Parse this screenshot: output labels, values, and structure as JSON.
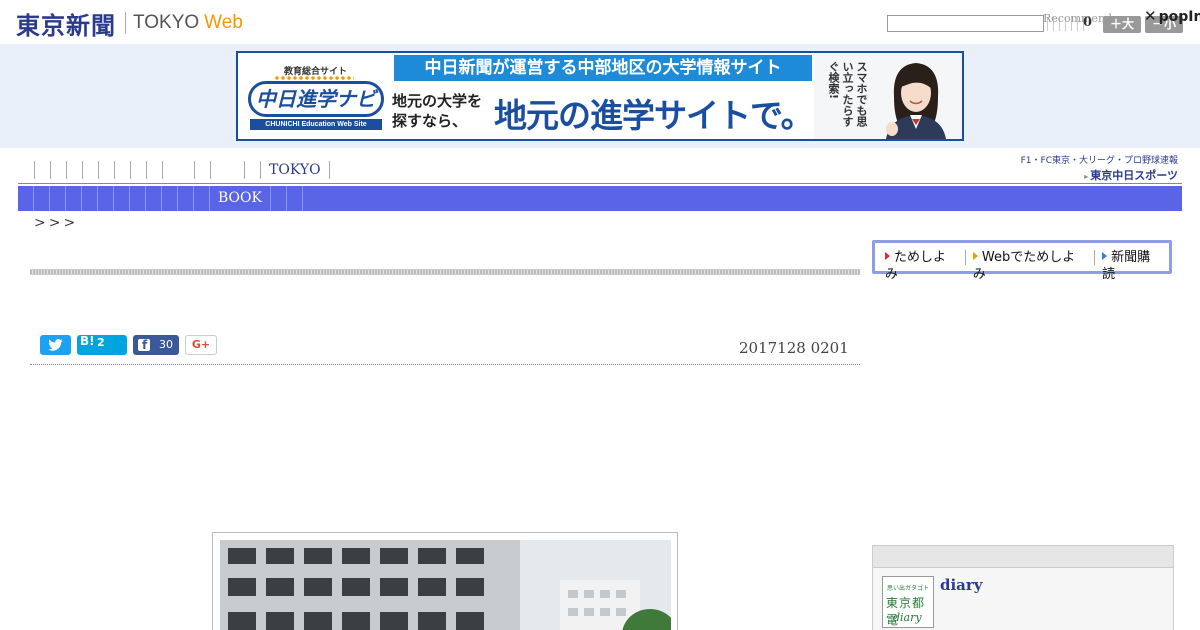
{
  "header": {
    "logo_jp": "東京新聞",
    "logo_tokyo": "TOKYO",
    "logo_web": "Web",
    "search_value": "",
    "recommend_label": "Recommend",
    "count": "0",
    "font_large_label": "＋大",
    "font_small_label": "－小",
    "popin_label": "popIn"
  },
  "ad": {
    "top_copy": "中日新聞が運営する中部地区の大学情報サイト",
    "logo_caption": "教育総合サイト",
    "logo_name": "中日進学ナビ",
    "logo_sub": "CHUNICHI Education Web Site",
    "mid_small": "地元の大学を探すなら、",
    "mid_big": "地元の進学サイトで。",
    "right_copy": "スマホでも思い立ったらすぐ検索!"
  },
  "nav": {
    "top_items": [
      "",
      "",
      "",
      "",
      "",
      "",
      "",
      "",
      "",
      "",
      "",
      "",
      "TOKYO"
    ],
    "sports_line1": "F1・FC東京・大リーグ・プロ野球速報",
    "sports_line2": "東京中日スポーツ",
    "bar_items": [
      "",
      "",
      "",
      "",
      "",
      "",
      "",
      "",
      "",
      "",
      "",
      "",
      "BOOK",
      "",
      ""
    ]
  },
  "breadcrumb": ">>>",
  "article": {
    "date": "2017128 0201",
    "hatena_count": "2",
    "facebook_count": "30",
    "gplus_label": "G+"
  },
  "sidebar": {
    "subscribe_links": [
      "ためしよみ",
      "Webでためしよみ",
      "新聞購読"
    ],
    "diary_title": "diary",
    "diary_thumb_caption": "思い出ガタゴト",
    "diary_thumb_name": "東京都電",
    "diary_thumb_sub": "diary"
  },
  "colors": {
    "brand_navy": "#2a3a8c",
    "nav_bar": "#5a64e6",
    "web_orange": "#f39800",
    "twitter": "#1da1f2",
    "hatena": "#00a4de",
    "facebook": "#3b5998"
  }
}
